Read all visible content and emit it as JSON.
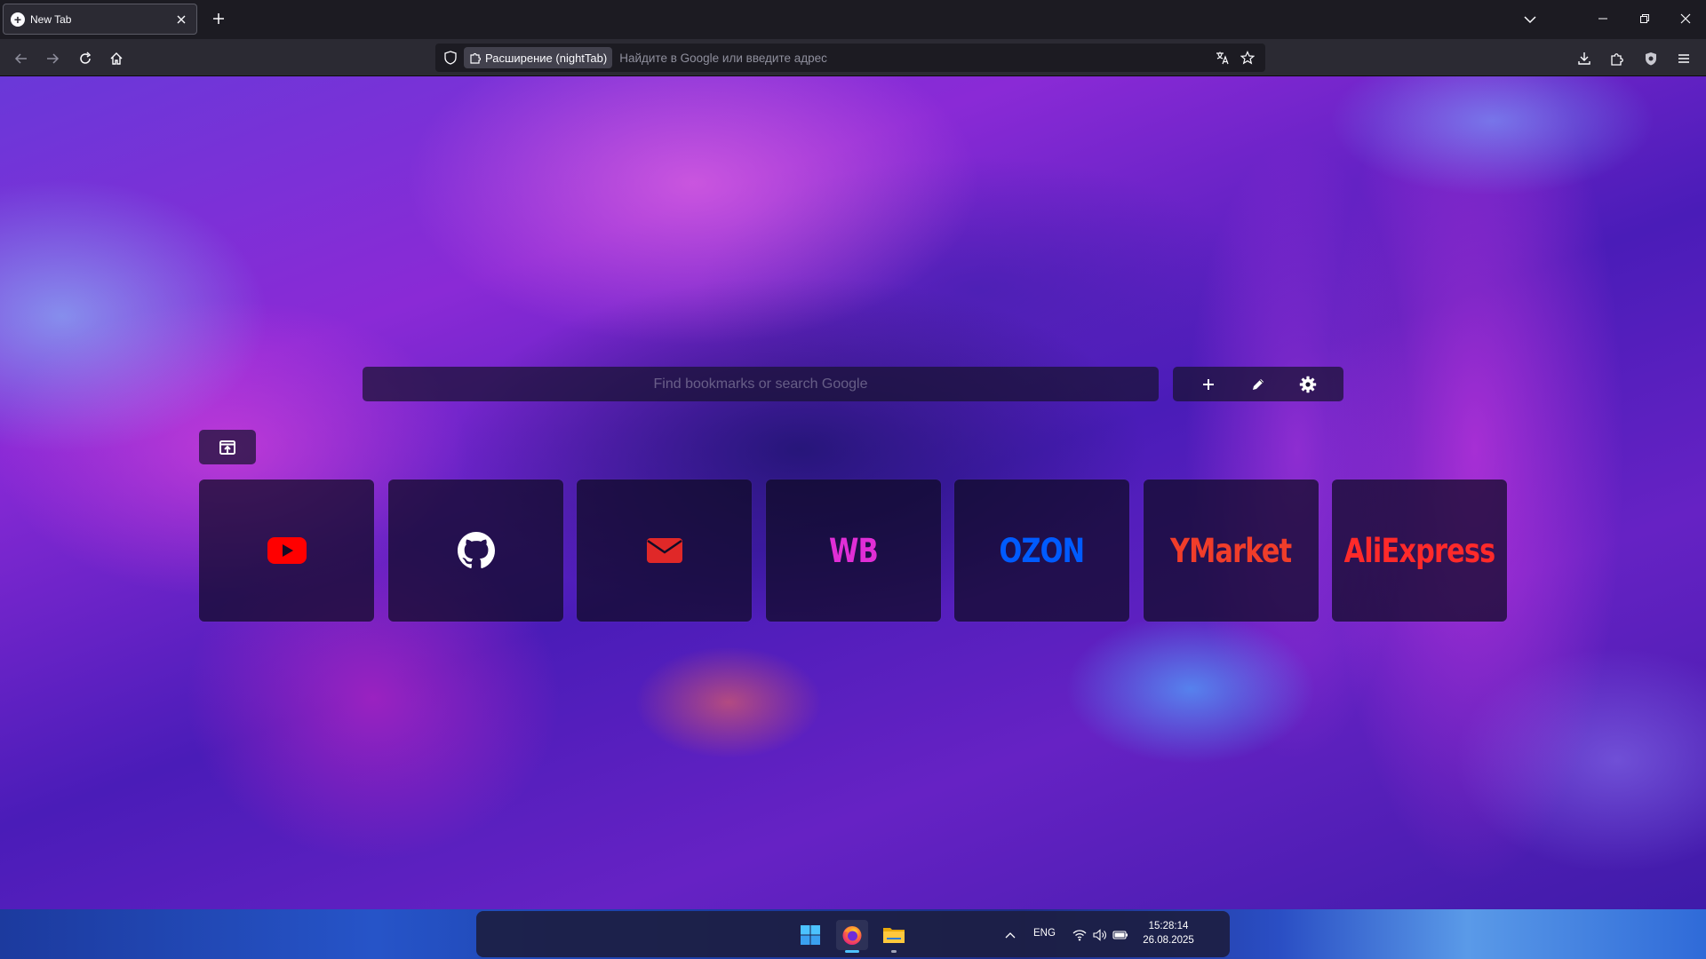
{
  "browser": {
    "tab": {
      "title": "New Tab"
    },
    "urlbar": {
      "extension_label": "Расширение (nightTab)",
      "placeholder": "Найдите в Google или введите адрес"
    }
  },
  "nighttab": {
    "search": {
      "placeholder": "Find bookmarks or search Google"
    },
    "tiles": [
      {
        "kind": "icon",
        "icon": "youtube-icon",
        "color": "#ff0000"
      },
      {
        "kind": "icon",
        "icon": "github-icon",
        "color": "#ffffff"
      },
      {
        "kind": "icon",
        "icon": "envelope-icon",
        "color": "#e02828"
      },
      {
        "kind": "letters",
        "text": "WB",
        "color": "#e02ed6"
      },
      {
        "kind": "letters",
        "text": "OZON",
        "color": "#005bff"
      },
      {
        "kind": "letters",
        "text": "YMarket",
        "color": "#f03d2a"
      },
      {
        "kind": "letters",
        "text": "AliExpress",
        "color": "#ff2a2a"
      }
    ]
  },
  "taskbar": {
    "language": "ENG",
    "time": "15:28:14",
    "date": "26.08.2025"
  }
}
